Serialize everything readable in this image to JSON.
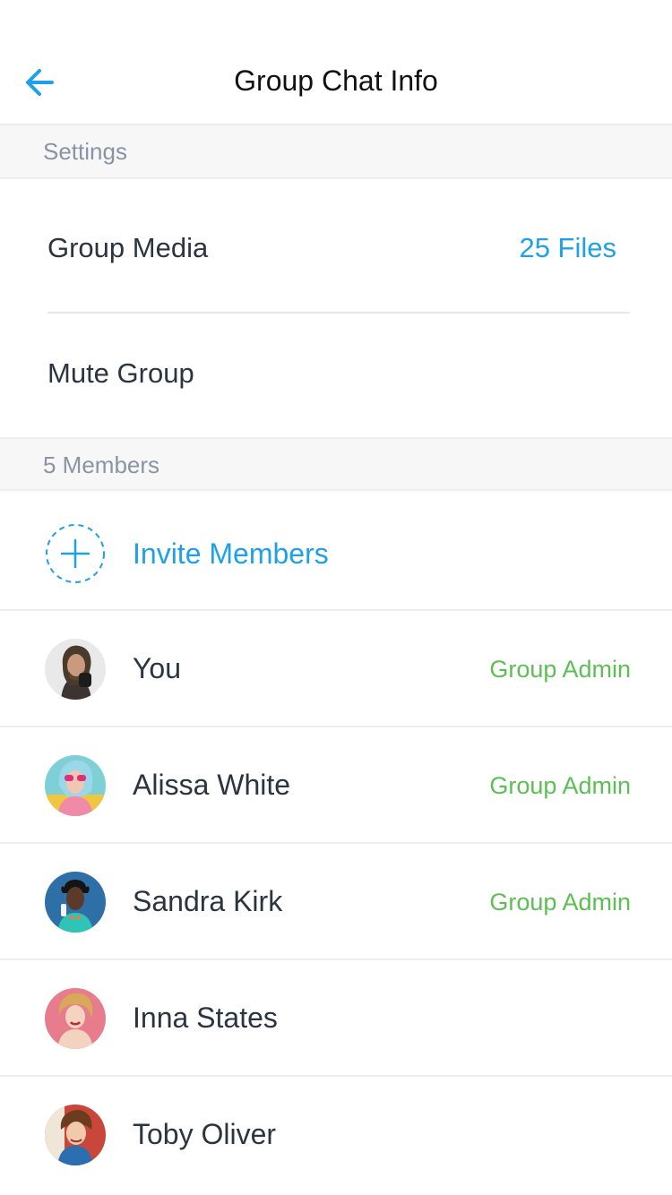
{
  "header": {
    "title": "Group Chat Info",
    "back_icon": "arrow-left-icon",
    "accent_color": "#1ea1e8"
  },
  "settings_section": {
    "title": "Settings",
    "items": [
      {
        "label": "Group Media",
        "value": "25 Files"
      },
      {
        "label": "Mute Group",
        "value": ""
      }
    ]
  },
  "members_section": {
    "title": "5 Members",
    "invite_label": "Invite Members",
    "invite_icon": "plus-icon",
    "role_color": "#5cbf53",
    "members": [
      {
        "name": "You",
        "role": "Group Admin"
      },
      {
        "name": "Alissa White",
        "role": "Group Admin"
      },
      {
        "name": "Sandra Kirk",
        "role": "Group Admin"
      },
      {
        "name": "Inna States",
        "role": ""
      },
      {
        "name": "Toby Oliver",
        "role": ""
      }
    ]
  }
}
